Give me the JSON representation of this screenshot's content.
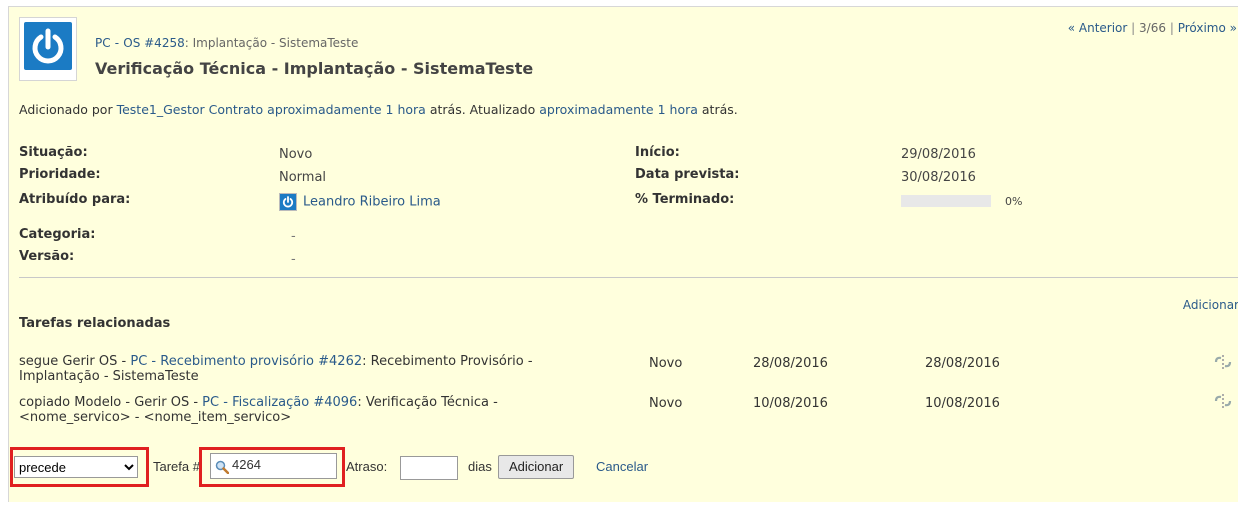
{
  "nav": {
    "prev": "« Anterior",
    "position": "3/66",
    "separator": "|",
    "next": "Próximo »"
  },
  "subject": {
    "project": "PC",
    "sep1": "-",
    "issue_ref": "OS #4258",
    "rest": ": Implantação - SistemaTeste",
    "title": "Verificação Técnica - Implantação - SistemaTeste"
  },
  "added": {
    "prefix": "Adicionado por",
    "author": "Teste1_Gestor Contrato",
    "age": "aproximadamente 1 hora",
    "mid": "atrás. Atualizado",
    "updated_age": "aproximadamente 1 hora",
    "suffix": "atrás."
  },
  "attributes": {
    "status_label": "Situação:",
    "status_value": "Novo",
    "priority_label": "Prioridade:",
    "priority_value": "Normal",
    "assigned_label": "Atribuído para:",
    "assigned_value": "Leandro Ribeiro Lima",
    "category_label": "Categoria:",
    "category_value": "-",
    "version_label": "Versão:",
    "version_value": "-",
    "start_label": "Início:",
    "start_value": "29/08/2016",
    "due_label": "Data prevista:",
    "due_value": "30/08/2016",
    "done_label": "% Terminado:",
    "done_value": "0%",
    "done_ratio": 0
  },
  "relations": {
    "heading": "Tarefas relacionadas",
    "add_link": "Adicionar",
    "rows": [
      {
        "relation": "segue Gerir OS -",
        "project": "PC",
        "sep": "-",
        "link": "Recebimento provisório #4262",
        "title": ": Recebimento Provisório -",
        "title2": "Implantação - SistemaTeste",
        "status": "Novo",
        "start": "28/08/2016",
        "due": "28/08/2016"
      },
      {
        "relation": "copiado Modelo - Gerir OS -",
        "project": "PC",
        "sep": "-",
        "link": "Fiscalização #4096",
        "title": ": Verificação Técnica -",
        "title2": "<nome_servico> - <nome_item_servico>",
        "status": "Novo",
        "start": "10/08/2016",
        "due": "10/08/2016"
      }
    ]
  },
  "form": {
    "relation_type": "precede",
    "issue_label": "Tarefa #",
    "issue_value": "4264",
    "delay_label": "Atraso:",
    "delay_value": "",
    "days_label": "dias",
    "submit": "Adicionar",
    "cancel": "Cancelar"
  },
  "colors": {
    "link": "#2a5a8a",
    "background": "#ffffdd",
    "highlight": "#e02020",
    "logo": "#1b7bc4"
  },
  "icons": [
    "power-logo-icon",
    "user-avatar-icon",
    "magnifier-icon",
    "unlink-icon",
    "chevron-down-icon"
  ]
}
